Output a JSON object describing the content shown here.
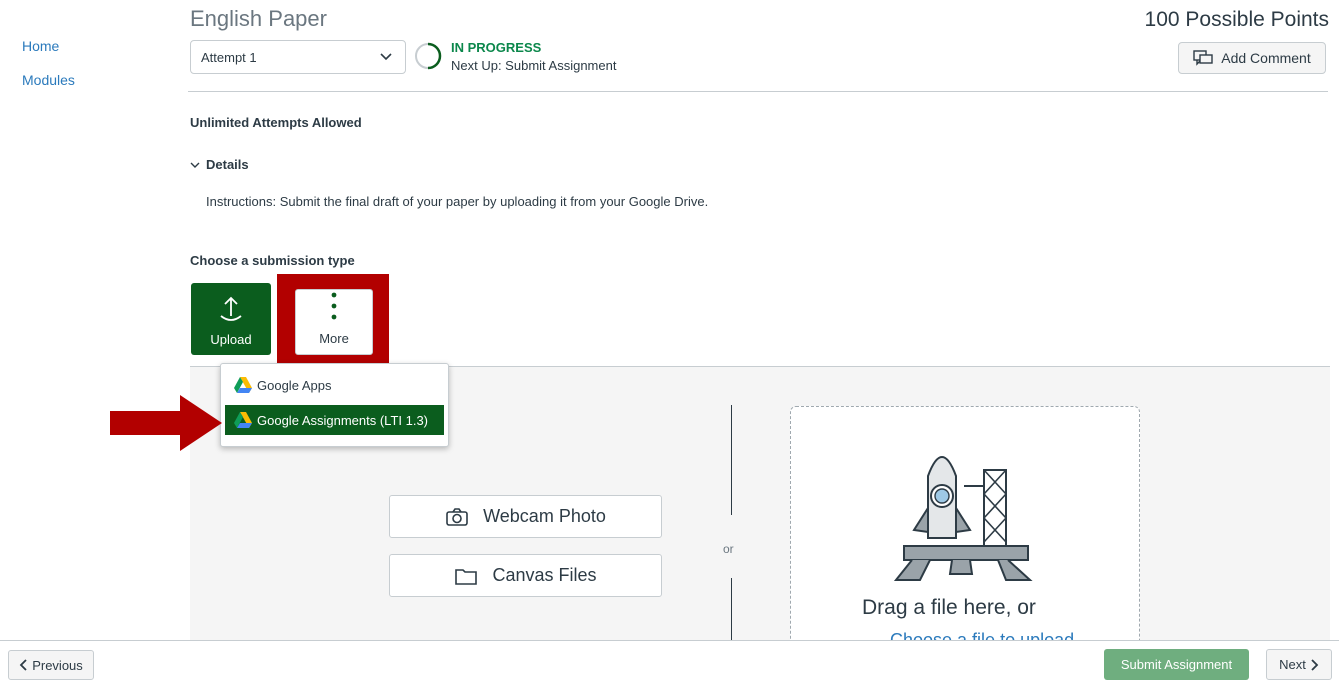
{
  "nav": {
    "items": [
      {
        "label": "Home"
      },
      {
        "label": "Modules"
      }
    ]
  },
  "header": {
    "title": "English Paper",
    "points": "100 Possible Points",
    "attempt_select": "Attempt 1",
    "status": "IN PROGRESS",
    "next_up": "Next Up: Submit Assignment",
    "add_comment": "Add Comment"
  },
  "details": {
    "attempts_allowed": "Unlimited Attempts Allowed",
    "toggle_label": "Details",
    "instructions": "Instructions: Submit the final draft of your paper by uploading it from your Google Drive."
  },
  "submission": {
    "choose_label": "Choose a submission type",
    "types": [
      {
        "label": "Upload",
        "icon": "upload-icon",
        "selected": true
      },
      {
        "label": "More",
        "icon": "kebab-icon",
        "highlighted": true
      }
    ],
    "more_menu": [
      {
        "label": "Google Apps",
        "icon": "google-drive-icon"
      },
      {
        "label": "Google Assignments (LTI 1.3)",
        "icon": "google-drive-icon",
        "selected": true
      }
    ]
  },
  "upload_panel": {
    "webcam_label": "Webcam Photo",
    "canvas_files_label": "Canvas Files",
    "or_label": "or",
    "drop_text": "Drag a file here, or",
    "choose_link": "Choose a file to upload"
  },
  "footer": {
    "previous": "Previous",
    "submit": "Submit Assignment",
    "next": "Next"
  },
  "colors": {
    "brand_green": "#0b5d1e",
    "status_green": "#0b874b",
    "link_blue": "#2b7abc",
    "highlight_red": "#b20000",
    "submit_disabled": "#6fae7f"
  }
}
